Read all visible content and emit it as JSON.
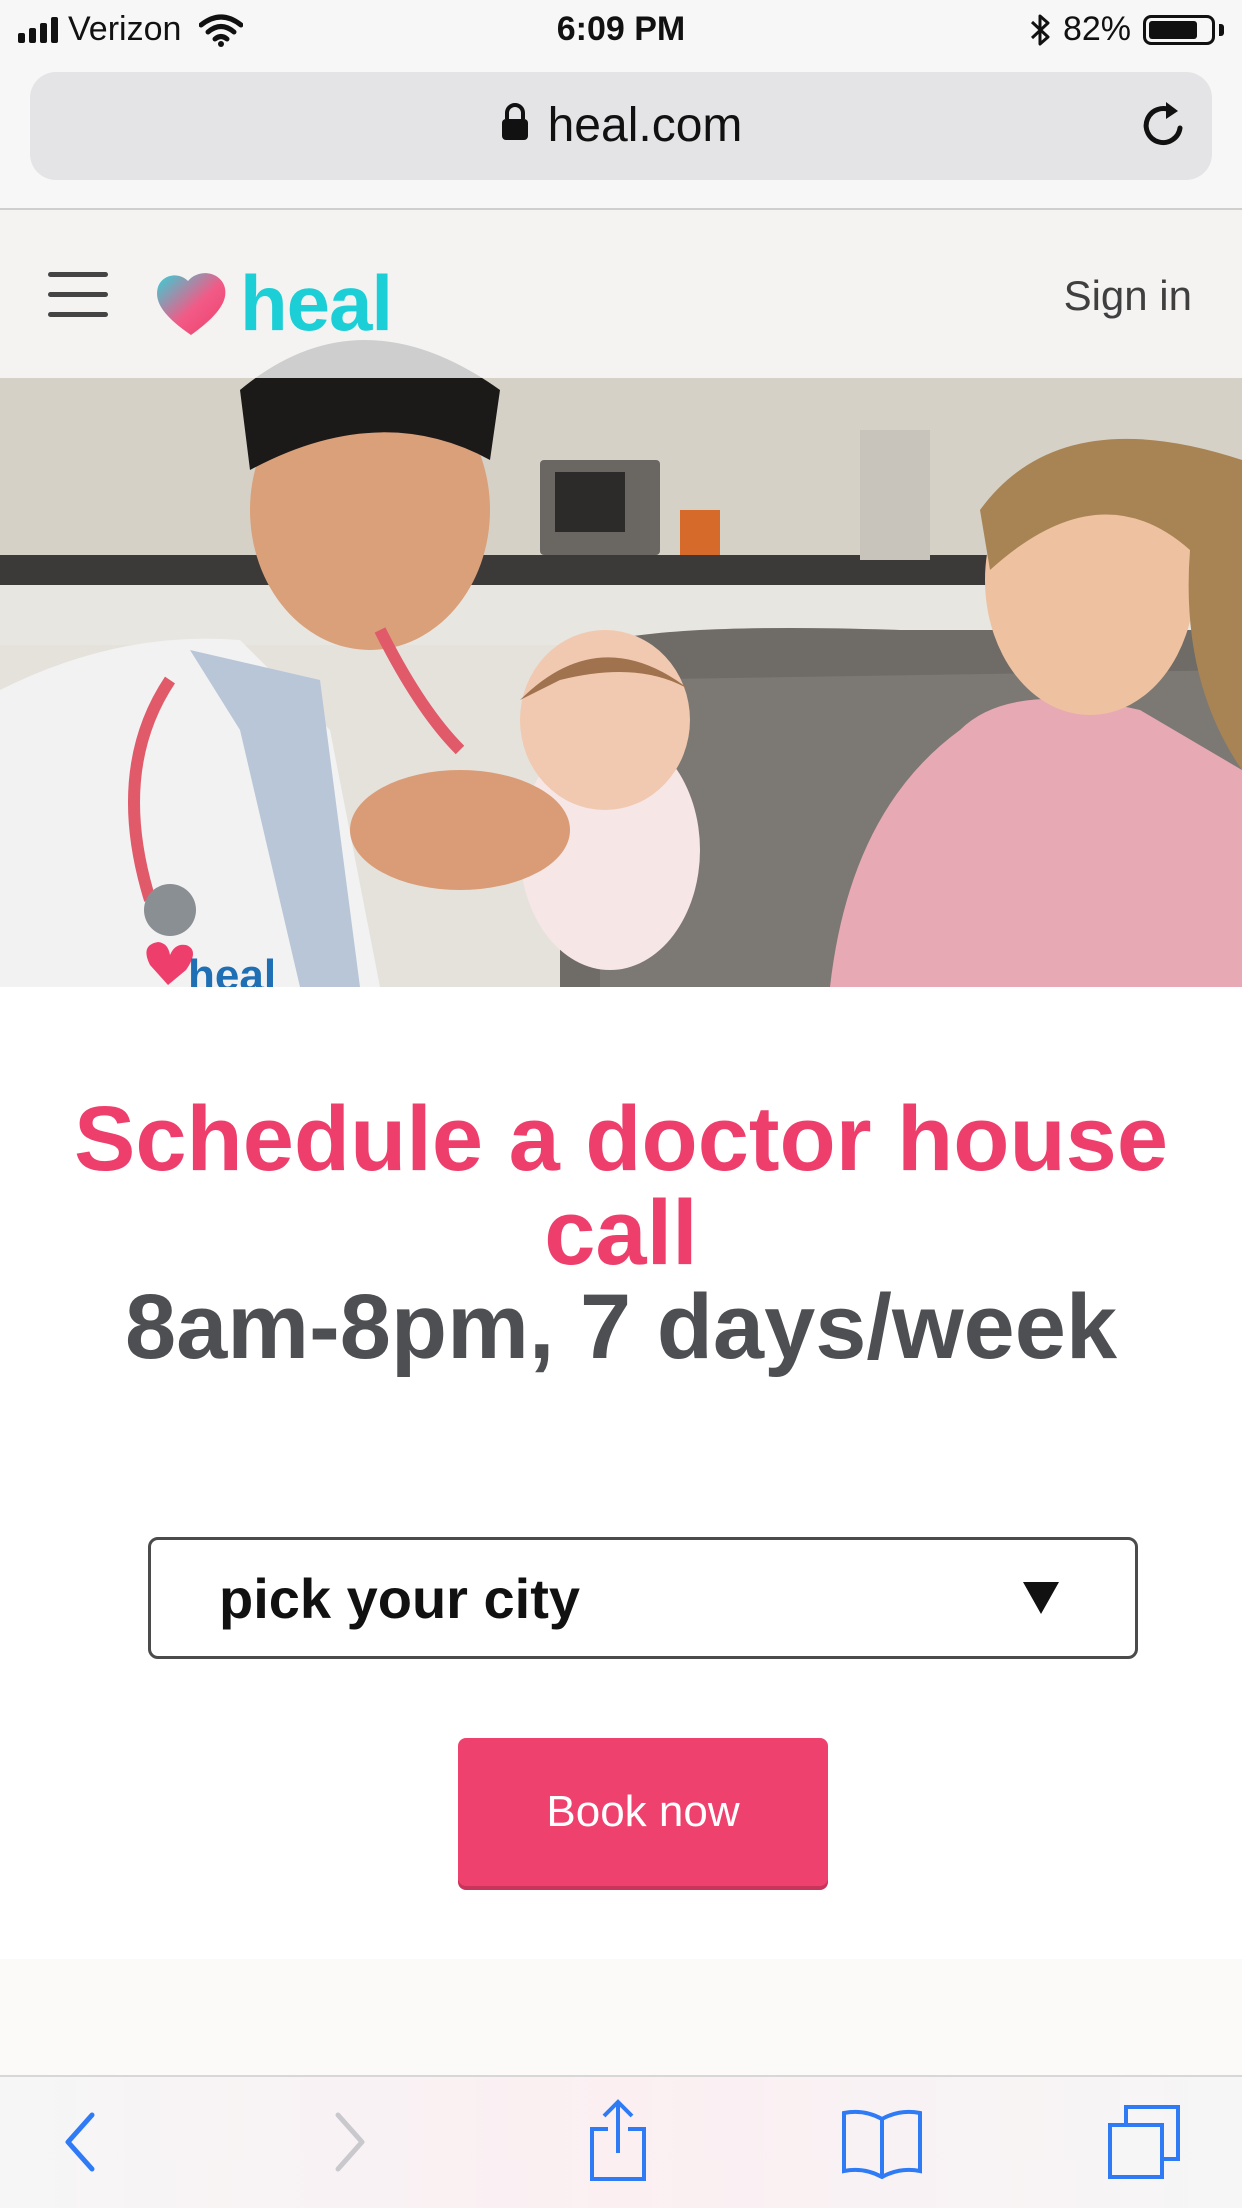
{
  "status_bar": {
    "carrier": "Verizon",
    "time": "6:09 PM",
    "battery_percent": "82%",
    "battery_level": 0.82
  },
  "browser": {
    "url": "heal.com"
  },
  "site_header": {
    "logo_text": "heal",
    "sign_in_label": "Sign in"
  },
  "main": {
    "headline_line1": "Schedule a doctor house call",
    "headline_line2": "8am-8pm, 7 days/week",
    "city_select_value": "pick your city",
    "book_button_label": "Book now"
  },
  "colors": {
    "brand_pink": "#ee3f6c",
    "brand_teal": "#1ccfd6",
    "ios_blue": "#2f7bf5"
  },
  "icons": {
    "status": [
      "signal-icon",
      "wifi-icon",
      "bluetooth-icon",
      "battery-icon"
    ],
    "browser": [
      "lock-icon",
      "reload-icon"
    ],
    "toolbar": [
      "back-icon",
      "forward-icon",
      "share-icon",
      "bookmarks-icon",
      "tabs-icon"
    ]
  }
}
